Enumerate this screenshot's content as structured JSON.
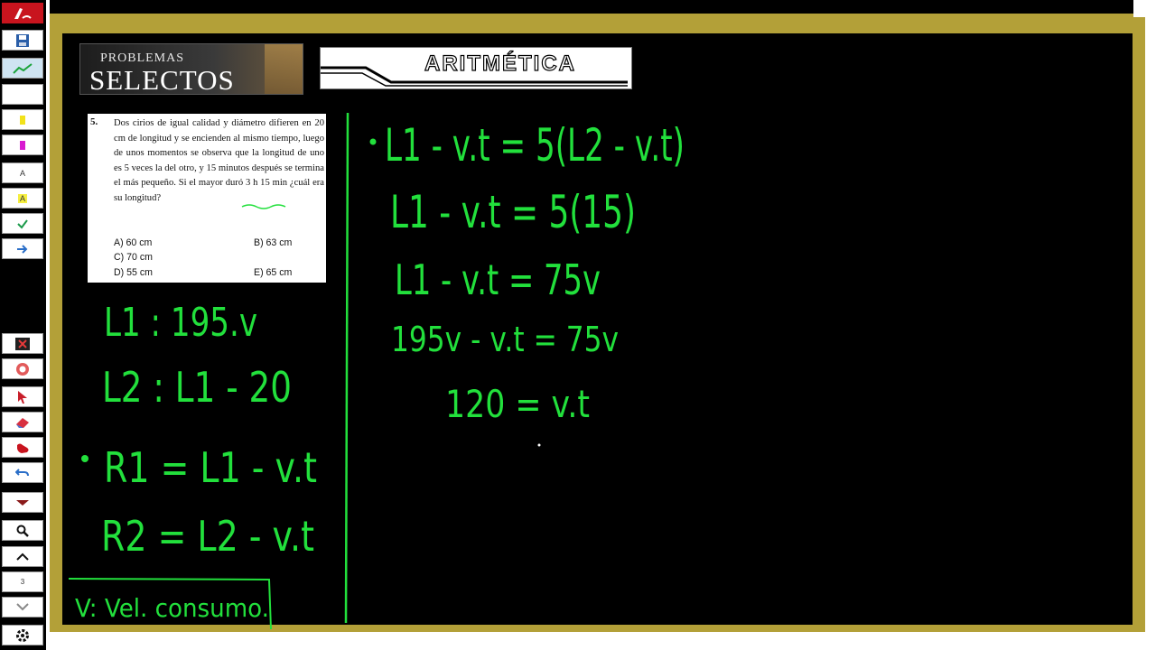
{
  "toolbar": {
    "items": [
      {
        "name": "pen-icon",
        "label": ""
      },
      {
        "name": "save-icon",
        "label": ""
      },
      {
        "name": "trend-icon",
        "label": ""
      },
      {
        "name": "blank-icon",
        "label": ""
      },
      {
        "name": "yellow-marker-icon",
        "label": ""
      },
      {
        "name": "magenta-marker-icon",
        "label": ""
      },
      {
        "name": "text-small-icon",
        "label": "A"
      },
      {
        "name": "text-highlight-icon",
        "label": "A"
      },
      {
        "name": "check-icon",
        "label": ""
      },
      {
        "name": "arrow-right-icon",
        "label": ""
      },
      {
        "name": "close-icon",
        "label": ""
      },
      {
        "name": "record-icon",
        "label": ""
      },
      {
        "name": "pointer-icon",
        "label": ""
      },
      {
        "name": "eraser-icon",
        "label": ""
      },
      {
        "name": "hand-icon",
        "label": ""
      },
      {
        "name": "undo-icon",
        "label": ""
      },
      {
        "name": "dropdown-icon",
        "label": ""
      },
      {
        "name": "zoom-icon",
        "label": ""
      },
      {
        "name": "chevron-up-icon",
        "label": ""
      },
      {
        "name": "page-indicator",
        "label": "3"
      },
      {
        "name": "chevron-down-icon",
        "label": ""
      },
      {
        "name": "settings-icon",
        "label": ""
      }
    ]
  },
  "banners": {
    "problemas": "PROBLEMAS",
    "selectos": "SELECTOS",
    "aritmetica": "ARITMÉTICA"
  },
  "problem": {
    "number": "5.",
    "text": "Dos cirios de igual calidad y diámetro difieren en 20 cm de longitud y se encienden al mismo tiempo, luego de unos momentos se observa que la longitud de uno es 5 veces la del otro, y 15 minutos después se termina el más pequeño. Si el mayor duró 3 h 15 min ¿cuál era su longitud?",
    "options": [
      "A) 60 cm",
      "B) 63 cm",
      "C) 70 cm",
      "D) 55 cm",
      "E) 65 cm"
    ]
  },
  "handwriting": {
    "left": [
      "L1 : 195.v",
      "L2 : L1 - 20",
      "R1 = L1 - v.t",
      "R2 = L2 - v.t",
      "V: Vel. consumo."
    ],
    "right": [
      "L1 - v.t = 5(L2 - v.t)",
      "L1 - v.t = 5(15)",
      "L1 - v.t = 75v",
      "195v - v.t = 75v",
      "120 = v.t"
    ]
  },
  "colors": {
    "ink": "#22e03c",
    "board": "#000000",
    "frame": "#b3a038"
  }
}
